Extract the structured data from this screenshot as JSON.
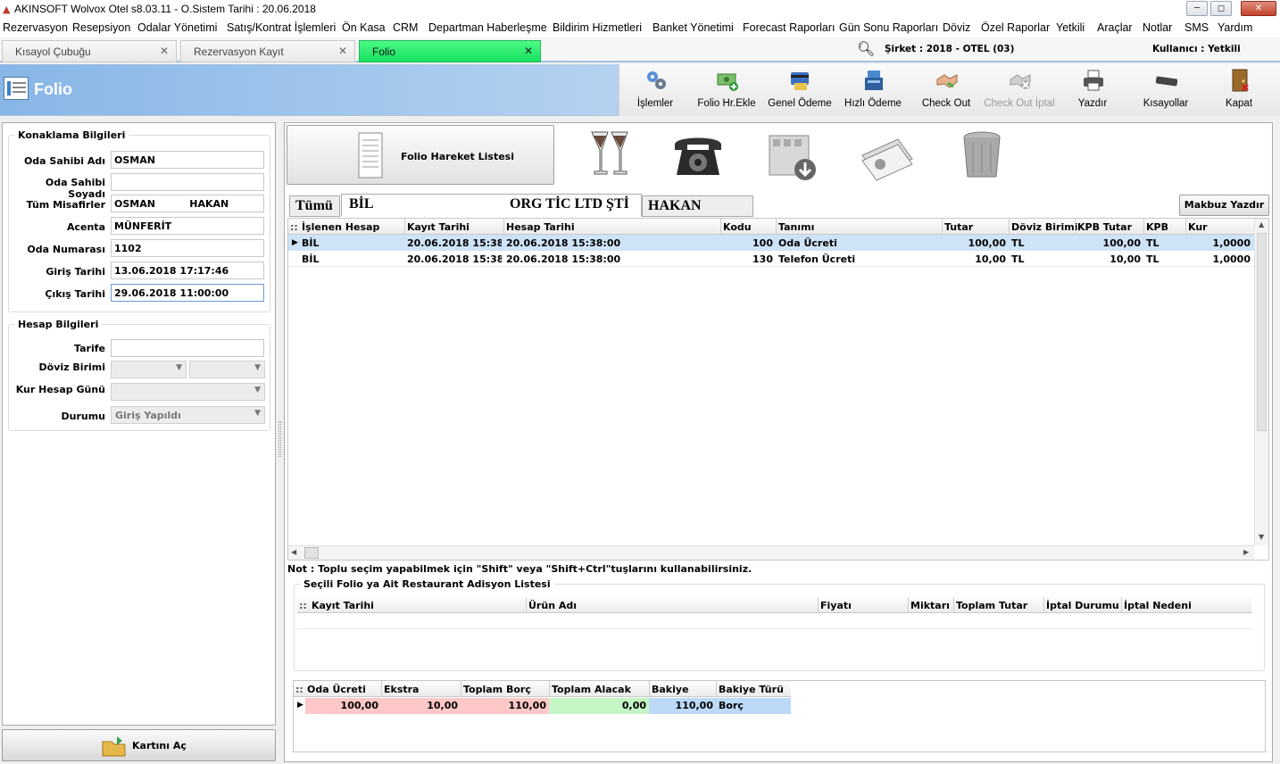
{
  "window": {
    "title": "AKINSOFT Wolvox Otel s8.03.11 - O.Sistem Tarihi : 20.06.2018",
    "min": "─",
    "max": "◻",
    "close": "✕"
  },
  "menu": [
    "Rezervasyon",
    "Resepsiyon",
    "Odalar Yönetimi",
    "Satış/Kontrat İşlemleri",
    "Ön Kasa",
    "CRM",
    "Departman Haberleşme",
    "Bildirim Hizmetleri",
    "Banket Yönetimi",
    "Forecast Raporları",
    "Gün Sonu Raporları",
    "Döviz",
    "Özel Raporlar",
    "Yetkili",
    "Araçlar",
    "Notlar",
    "SMS",
    "Yardım"
  ],
  "tabs": [
    {
      "label": "Kısayol Çubuğu",
      "close": "✕"
    },
    {
      "label": "Rezervasyon Kayıt",
      "close": "✕"
    },
    {
      "label": "Folio",
      "close": "✕"
    }
  ],
  "company": "Şirket : 2018 - OTEL (03)",
  "user": "Kullanıcı : Yetkili",
  "header_title": "Folio",
  "toolbar": [
    "İşlemler",
    "Folio Hr.Ekle",
    "Genel Ödeme",
    "Hızlı Ödeme",
    "Check Out",
    "Check Out İptal",
    "Yazdır",
    "Kısayollar",
    "Kapat"
  ],
  "konaklama": {
    "legend": "Konaklama Bilgileri",
    "labels": [
      "Oda Sahibi Adı",
      "Oda Sahibi Soyadı",
      "Tüm Misafirler",
      "Acenta",
      "Oda Numarası",
      "Giriş Tarihi",
      "Çıkış Tarihi"
    ],
    "values": [
      "OSMAN",
      "",
      "OSMAN          HAKAN",
      "MÜNFERİT",
      "1102",
      "13.06.2018 17:17:46",
      "29.06.2018 11:00:00"
    ]
  },
  "hesap": {
    "legend": "Hesap Bilgileri",
    "labels": [
      "Tarife",
      "Döviz Birimi",
      "Kur Hesap Günü",
      "Durumu"
    ],
    "durumu": "Giriş Yapıldı"
  },
  "kartini_ac": "Kartını Aç",
  "folio_list_btn": "Folio Hareket Listesi",
  "folio_tabs": [
    "Tümü",
    "BİL",
    "ORG TİC LTD ŞTİ",
    "HAKAN"
  ],
  "makbuz": "Makbuz Yazdır",
  "grid1": {
    "columns": [
      "İşlenen Hesap",
      "Kayıt Tarihi",
      "Hesap Tarihi",
      "Kodu",
      "Tanımı",
      "Tutar",
      "Döviz Birimi",
      "KPB Tutar",
      "KPB",
      "Kur"
    ],
    "rows": [
      [
        "BİL",
        "20.06.2018 15:38:0",
        "20.06.2018 15:38:00",
        "100",
        "Oda Ücreti",
        "100,00",
        "TL",
        "100,00",
        "TL",
        "1,0000"
      ],
      [
        "BİL",
        "20.06.2018 15:38:0",
        "20.06.2018 15:38:00",
        "130",
        "Telefon Ücreti",
        "10,00",
        "TL",
        "10,00",
        "TL",
        "1,0000"
      ]
    ]
  },
  "note": "Not : Toplu seçim yapabilmek için \"Shift\" veya \"Shift+Ctrl\"tuşlarını kullanabilirsiniz.",
  "adisyon": {
    "legend": "Seçili Folio ya Ait Restaurant Adisyon Listesi",
    "columns": [
      "Kayıt Tarihi",
      "Ürün Adı",
      "Fiyatı",
      "Miktarı",
      "Toplam Tutar",
      "İptal Durumu",
      "İptal Nedeni"
    ]
  },
  "summary": {
    "columns": [
      "Oda Ücreti",
      "Ekstra",
      "Toplam Borç",
      "Toplam Alacak",
      "Bakiye",
      "Bakiye Türü"
    ],
    "values": [
      "100,00",
      "10,00",
      "110,00",
      "0,00",
      "110,00",
      "Borç"
    ]
  },
  "colors": {
    "folio_tab": "#22e56a",
    "header": "#88b6e6",
    "borc": "#ffc8c8",
    "alacak": "#c4f5c4",
    "bakiye": "#bcd9f7",
    "selected_row": "#cfe3f7"
  }
}
